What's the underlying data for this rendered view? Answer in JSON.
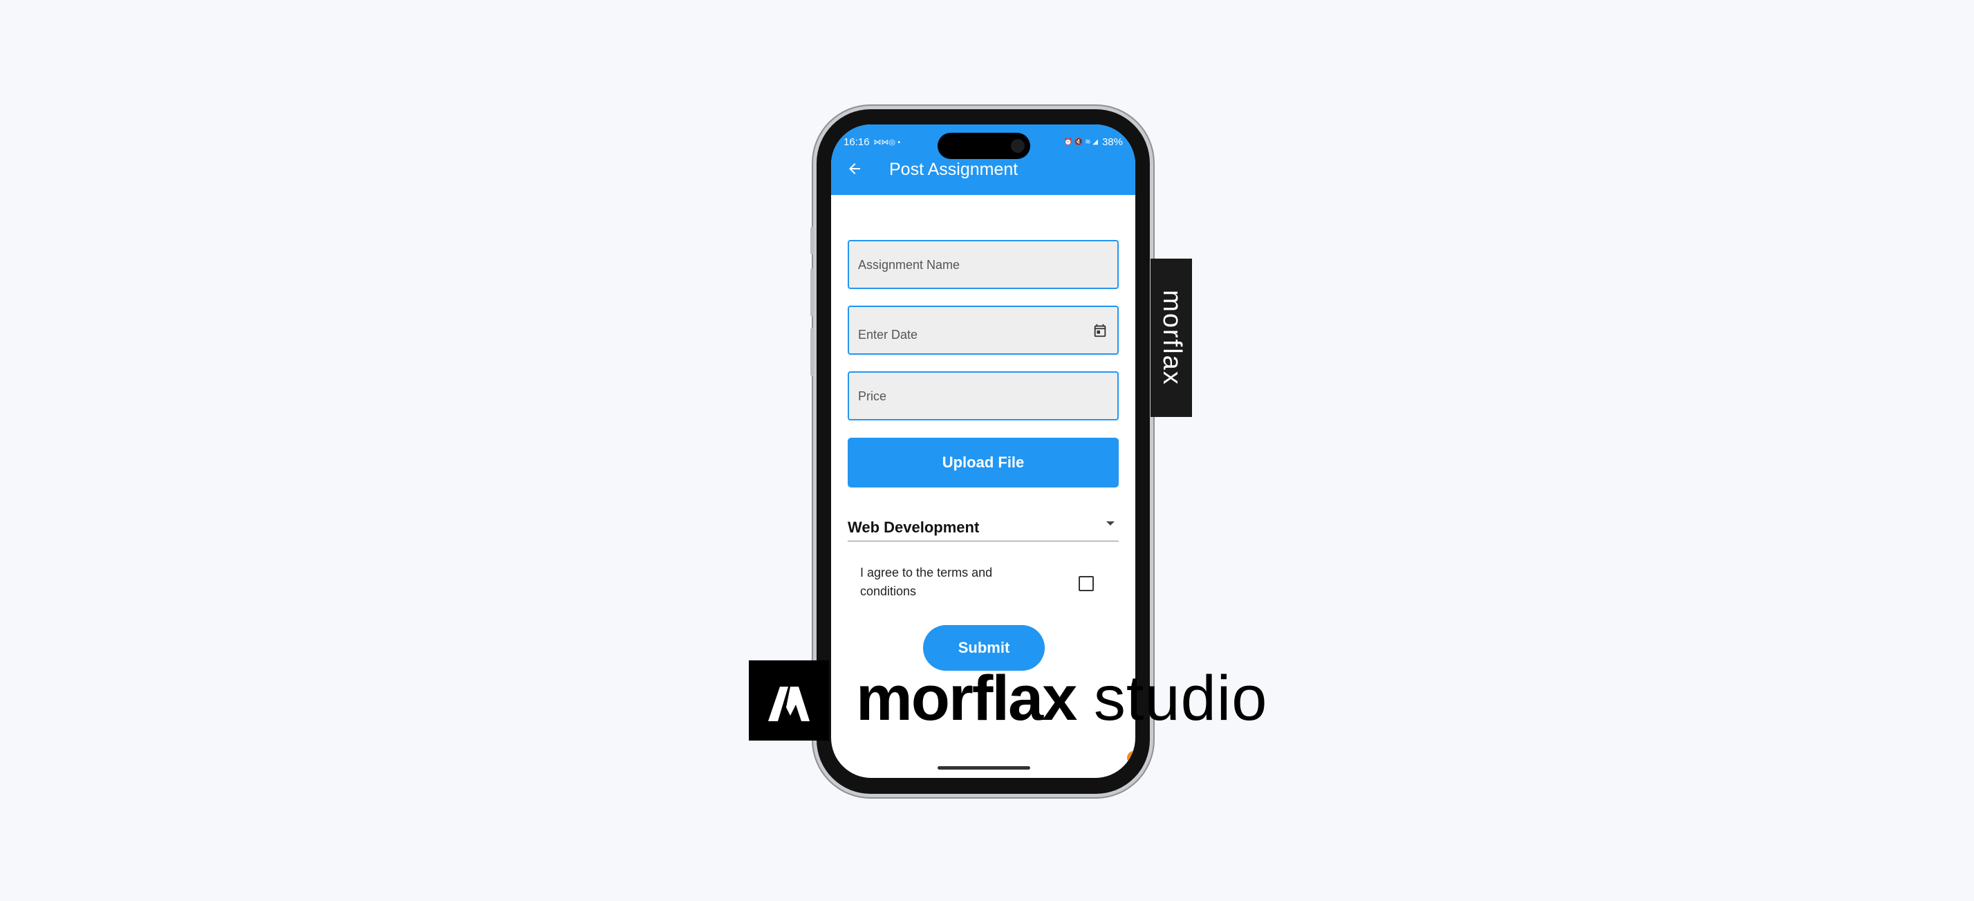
{
  "status_bar": {
    "time": "16:16",
    "left_icons": "⋈⋈◎ •",
    "right_icons": "⏰ 🔇 ≋ ◢",
    "battery": "38%"
  },
  "app_bar": {
    "title": "Post Assignment",
    "back_icon": "arrow-left-icon",
    "color": "#2196f3"
  },
  "form": {
    "assignment_name_placeholder": "Assignment Name",
    "date_placeholder": "Enter Date",
    "date_icon": "calendar-icon",
    "price_placeholder": "Price",
    "upload_label": "Upload File",
    "category_value": "Web Development",
    "terms_label": "I agree to the terms and conditions",
    "terms_checked": false,
    "submit_label": "Submit"
  },
  "branding": {
    "side_tag": "morflax",
    "logo_bold": "morflax",
    "logo_light": "studio"
  }
}
